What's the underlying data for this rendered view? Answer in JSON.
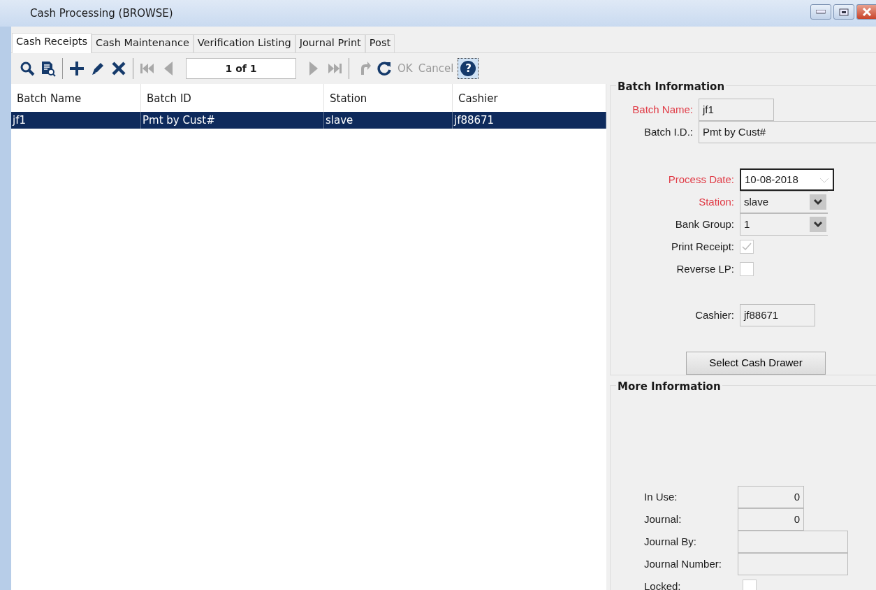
{
  "window": {
    "title": "Cash Processing (BROWSE)"
  },
  "tabs": [
    {
      "label": "Cash Receipts",
      "selected": true
    },
    {
      "label": "Cash Maintenance",
      "selected": false
    },
    {
      "label": "Verification Listing",
      "selected": false
    },
    {
      "label": "Journal Print",
      "selected": false
    },
    {
      "label": "Post",
      "selected": false
    }
  ],
  "toolbar": {
    "page": "1 of 1",
    "ok": {
      "label": "OK",
      "disabled": true
    },
    "cancel": {
      "label": "Cancel",
      "disabled": true
    },
    "help": "?"
  },
  "table": {
    "columns": [
      "Batch Name",
      "Batch ID",
      "Station",
      "Cashier"
    ],
    "rows": [
      {
        "cells": [
          "jf1",
          "Pmt by Cust#",
          "slave",
          "jf88671"
        ],
        "selected": true
      }
    ]
  },
  "batch_information": {
    "title": "Batch Information",
    "groups": [
      [
        {
          "kind": "text",
          "label": "Batch Name:",
          "value": "jf1",
          "required": true
        },
        {
          "kind": "text",
          "label": "Batch I.D.:",
          "value": "Pmt by Cust#",
          "required": false
        }
      ],
      [
        {
          "kind": "date",
          "label": "Process Date:",
          "value": "10-08-2018",
          "required": true
        },
        {
          "kind": "select",
          "label": "Station:",
          "value": "slave",
          "required": true
        },
        {
          "kind": "select",
          "label": "Bank Group:",
          "value": "1",
          "required": false
        },
        {
          "kind": "checkbox",
          "label": "Print Receipt:",
          "checked": true,
          "required": false
        },
        {
          "kind": "checkbox",
          "label": "Reverse LP:",
          "checked": false,
          "required": false
        }
      ],
      [
        {
          "kind": "text",
          "label": "Cashier:",
          "value": "jf88671",
          "required": false
        }
      ]
    ],
    "button": "Select Cash Drawer"
  },
  "more_information": {
    "title": "More Information",
    "fields": [
      {
        "kind": "number",
        "label": "In Use:",
        "value": "0"
      },
      {
        "kind": "number",
        "label": "Journal:",
        "value": "0"
      },
      {
        "kind": "text",
        "label": "Journal By:"
      },
      {
        "kind": "text",
        "label": "Journal Number:"
      },
      {
        "kind": "checkbox",
        "label": "Locked:",
        "checked": false
      }
    ]
  }
}
